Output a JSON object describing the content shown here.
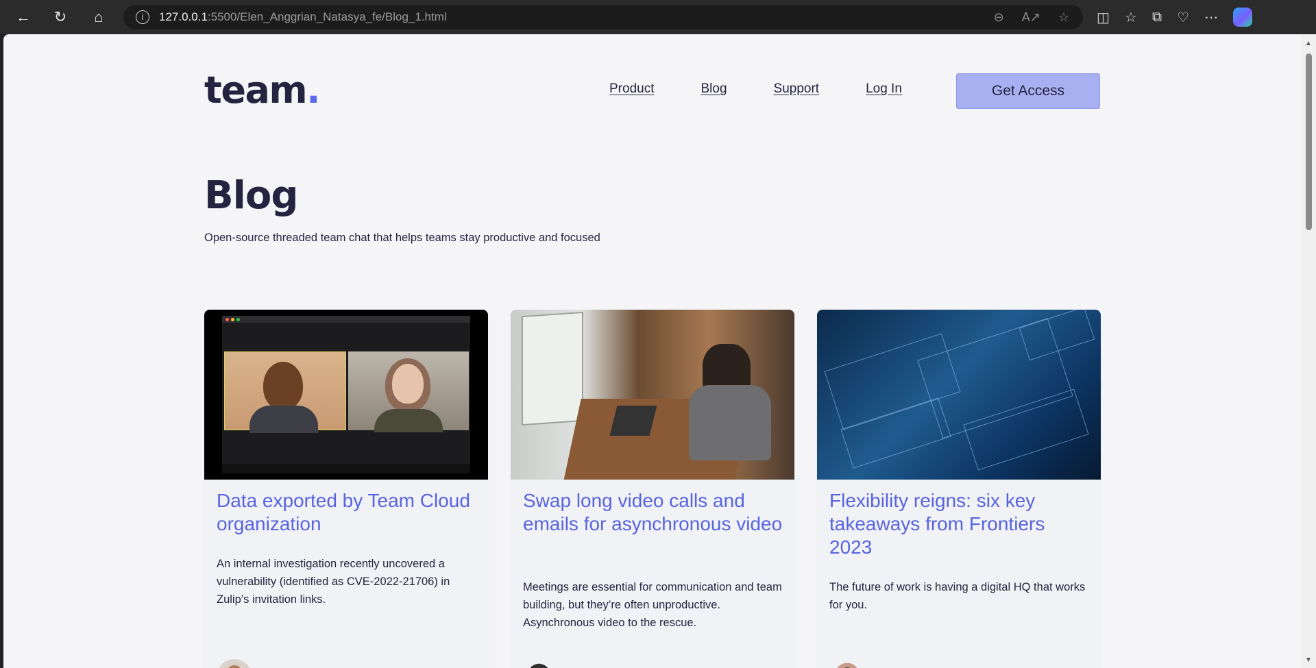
{
  "browser": {
    "url_host": "127.0.0.1",
    "url_path": ":5500/Elen_Anggrian_Natasya_fe/Blog_1.html"
  },
  "site": {
    "logo": "team",
    "logo_dot": ".",
    "nav": [
      "Product",
      "Blog",
      "Support",
      "Log In"
    ],
    "cta": "Get Access"
  },
  "page": {
    "title": "Blog",
    "subtitle": "Open-source threaded team chat that helps teams stay productive and focused"
  },
  "posts": [
    {
      "title": "Data exported by Team Cloud organization",
      "excerpt": "An internal investigation recently uncovered a vulnerability (identified as CVE-2022-21706) in Zulip’s invitation links.",
      "image": "video-call-photo"
    },
    {
      "title": "Swap long video calls and emails for asynchronous video",
      "excerpt": "Meetings are essential for communication and team building, but they’re often unproductive. Asynchronous video to the rescue.",
      "image": "woman-laptop-photo"
    },
    {
      "title": "Flexibility reigns: six key takeaways from Frontiers 2023",
      "excerpt": "The future of work is having a digital HQ that works for you.",
      "image": "blueprint-photo"
    }
  ],
  "colors": {
    "accent": "#5864df",
    "button": "#a8b0f1",
    "text": "#25233f",
    "page_bg": "#f5f5f7"
  }
}
